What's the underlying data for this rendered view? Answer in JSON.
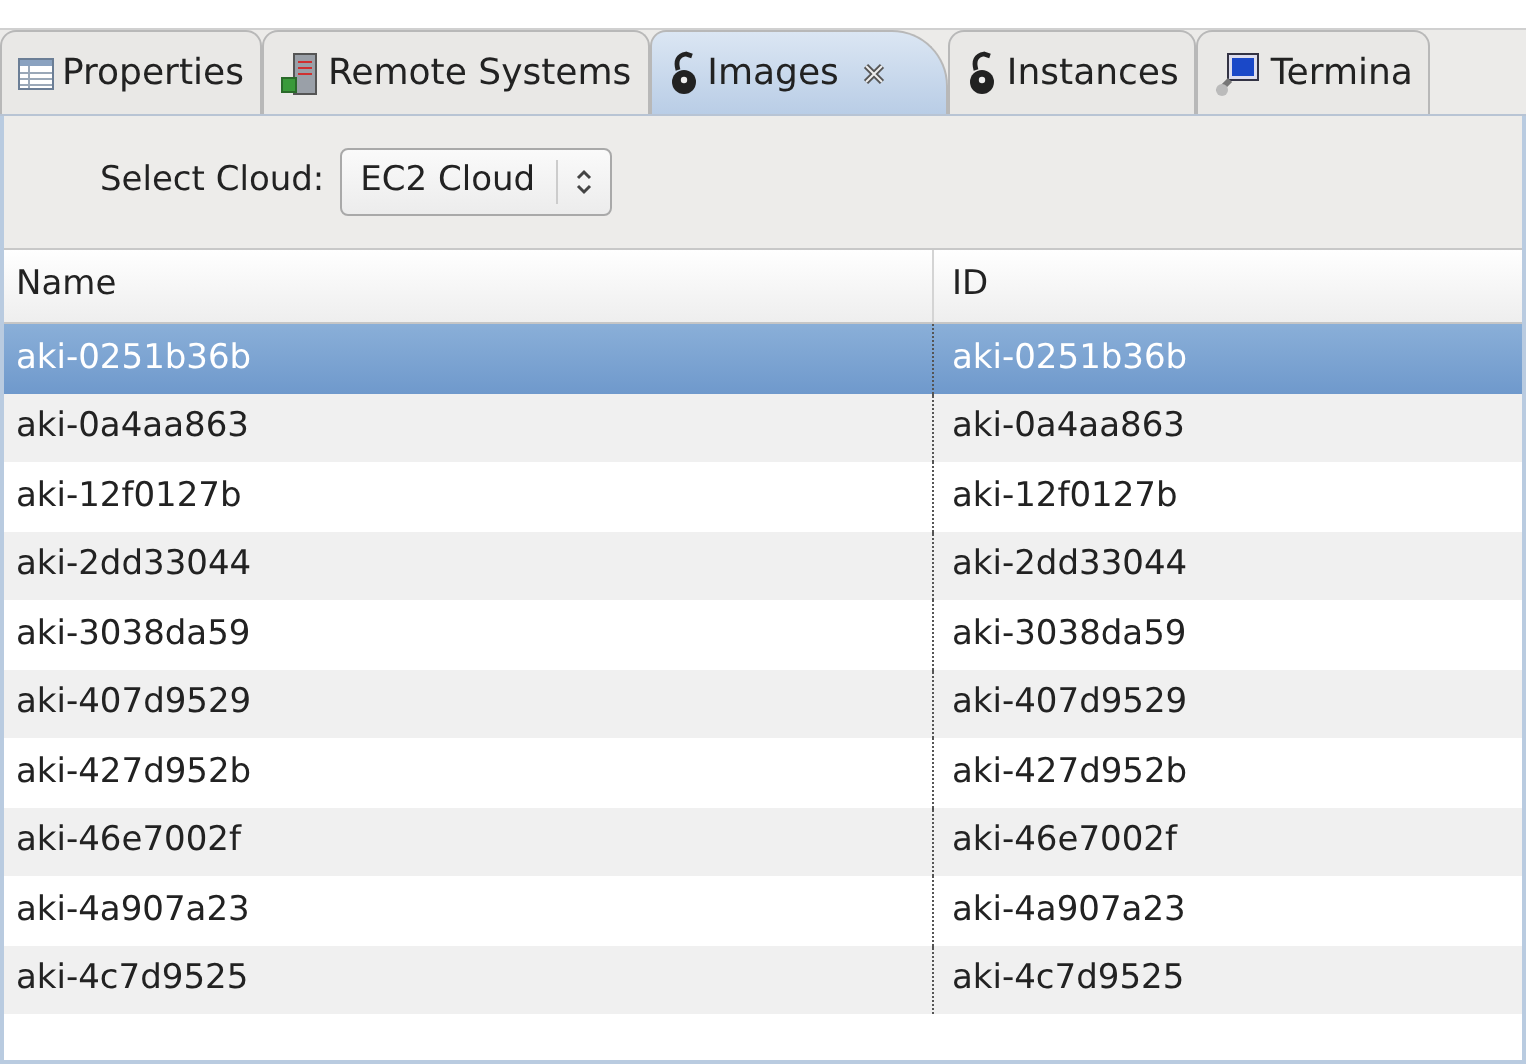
{
  "tabs": [
    {
      "label": "Properties",
      "kind": "table",
      "selected": false,
      "closable": false
    },
    {
      "label": "Remote Systems",
      "kind": "server",
      "selected": false,
      "closable": false
    },
    {
      "label": "Images",
      "kind": "cloud",
      "selected": true,
      "closable": true
    },
    {
      "label": "Instances",
      "kind": "cloud",
      "selected": false,
      "closable": false
    },
    {
      "label": "Termina",
      "kind": "terminal",
      "selected": false,
      "closable": false
    }
  ],
  "cloud_select": {
    "label": "Select Cloud:",
    "value": "EC2 Cloud"
  },
  "table": {
    "columns": [
      "Name",
      "ID"
    ],
    "rows": [
      {
        "cells": [
          "aki-0251b36b",
          "aki-0251b36b"
        ],
        "selected": true
      },
      {
        "cells": [
          "aki-0a4aa863",
          "aki-0a4aa863"
        ],
        "selected": false
      },
      {
        "cells": [
          "aki-12f0127b",
          "aki-12f0127b"
        ],
        "selected": false
      },
      {
        "cells": [
          "aki-2dd33044",
          "aki-2dd33044"
        ],
        "selected": false
      },
      {
        "cells": [
          "aki-3038da59",
          "aki-3038da59"
        ],
        "selected": false
      },
      {
        "cells": [
          "aki-407d9529",
          "aki-407d9529"
        ],
        "selected": false
      },
      {
        "cells": [
          "aki-427d952b",
          "aki-427d952b"
        ],
        "selected": false
      },
      {
        "cells": [
          "aki-46e7002f",
          "aki-46e7002f"
        ],
        "selected": false
      },
      {
        "cells": [
          "aki-4a907a23",
          "aki-4a907a23"
        ],
        "selected": false
      },
      {
        "cells": [
          "aki-4c7d9525",
          "aki-4c7d9525"
        ],
        "selected": false
      }
    ]
  }
}
